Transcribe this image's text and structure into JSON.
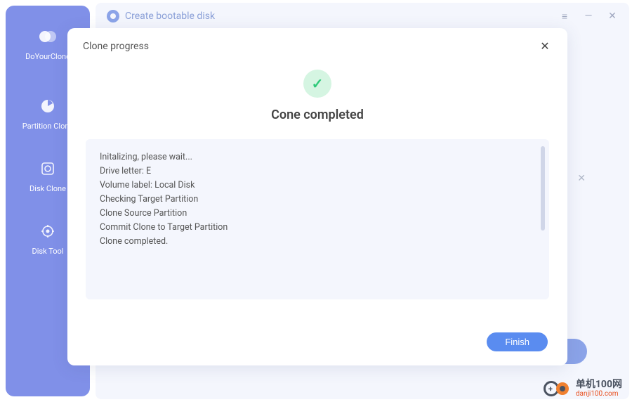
{
  "titlebar": {
    "title": "Create bootable disk"
  },
  "sidebar": {
    "logo_label": "DoYourClone",
    "items": [
      {
        "label": "Partition Clone"
      },
      {
        "label": "Disk Clone"
      },
      {
        "label": "Disk Tool"
      }
    ]
  },
  "modal": {
    "title": "Clone progress",
    "completed_title": "Cone completed",
    "log_lines": [
      "Initalizing, please wait...",
      "Drive letter: E",
      "Volume label: Local Disk",
      "Checking Target Partition",
      "Clone Source Partition",
      "Commit Clone to Target Partition",
      "Clone completed."
    ],
    "finish_label": "Finish"
  },
  "watermark": {
    "text_top": "单机100网",
    "text_bottom": "danji100.com"
  }
}
